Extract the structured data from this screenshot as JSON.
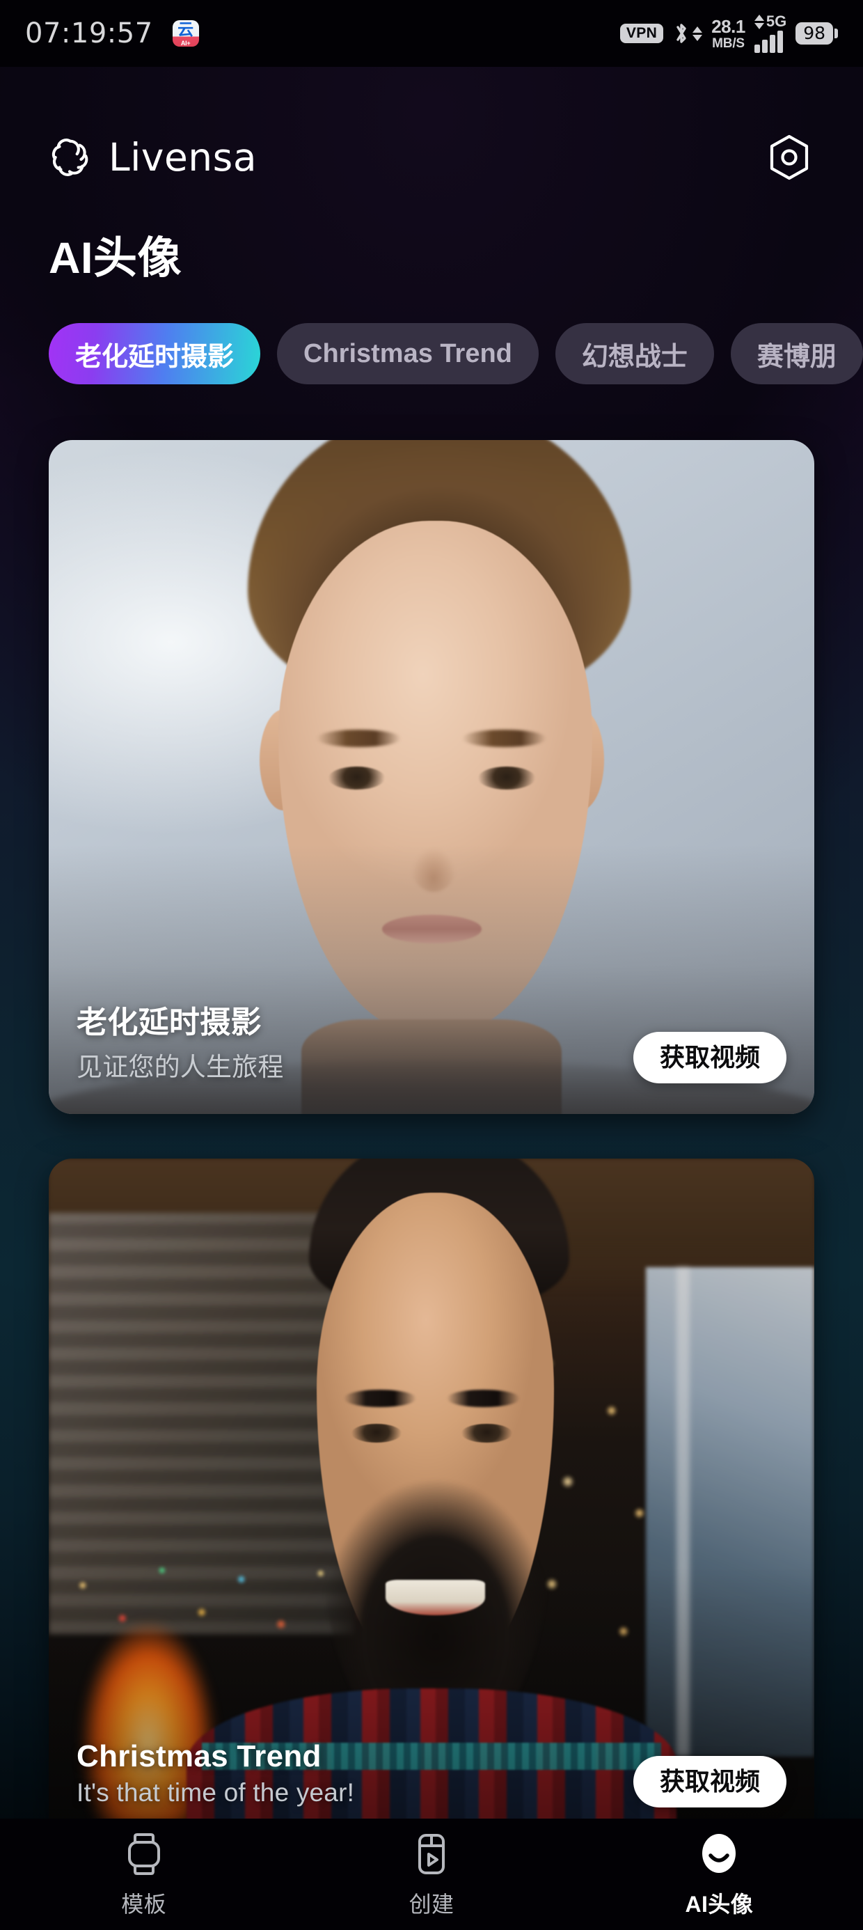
{
  "status_bar": {
    "time": "07:19:57",
    "app_icon_glyph": "云",
    "app_icon_tag": "AI+",
    "vpn_label": "VPN",
    "bluetooth_icon": "bluetooth-icon",
    "network_speed_value": "28.1",
    "network_speed_unit": "MB/S",
    "network_type": "5G",
    "signal_icon": "signal-bars-icon",
    "battery_level": "98"
  },
  "app_bar": {
    "logo_icon": "livensa-braided-ring-logo",
    "brand_name": "Livensa",
    "settings_icon": "hexagon-settings-icon"
  },
  "page": {
    "title": "AI头像"
  },
  "chips": [
    {
      "label": "老化延时摄影",
      "active": true
    },
    {
      "label": "Christmas Trend",
      "active": false
    },
    {
      "label": "幻想战士",
      "active": false
    },
    {
      "label": "赛博朋",
      "active": false
    }
  ],
  "cards": [
    {
      "title": "老化延时摄影",
      "subtitle": "见证您的人生旅程",
      "cta_label": "获取视频",
      "image_alt": "young-boy-portrait-light-background"
    },
    {
      "title": "Christmas Trend",
      "subtitle": "It's that time of the year!",
      "cta_label": "获取视频",
      "image_alt": "bearded-man-smiling-christmas-sweater-fireplace"
    }
  ],
  "bottom_nav": [
    {
      "label": "模板",
      "icon": "template-watch-icon",
      "active": false
    },
    {
      "label": "创建",
      "icon": "create-video-play-icon",
      "active": false
    },
    {
      "label": "AI头像",
      "icon": "smiley-face-avatar-icon",
      "active": true
    }
  ],
  "colors": {
    "accent_gradient_start": "#a233f5",
    "accent_gradient_end": "#2ad6d6",
    "chip_inactive_bg": "#363143",
    "cta_bg": "#ffffff",
    "background_top": "#1d0d30",
    "background_mid": "#0c2733"
  }
}
